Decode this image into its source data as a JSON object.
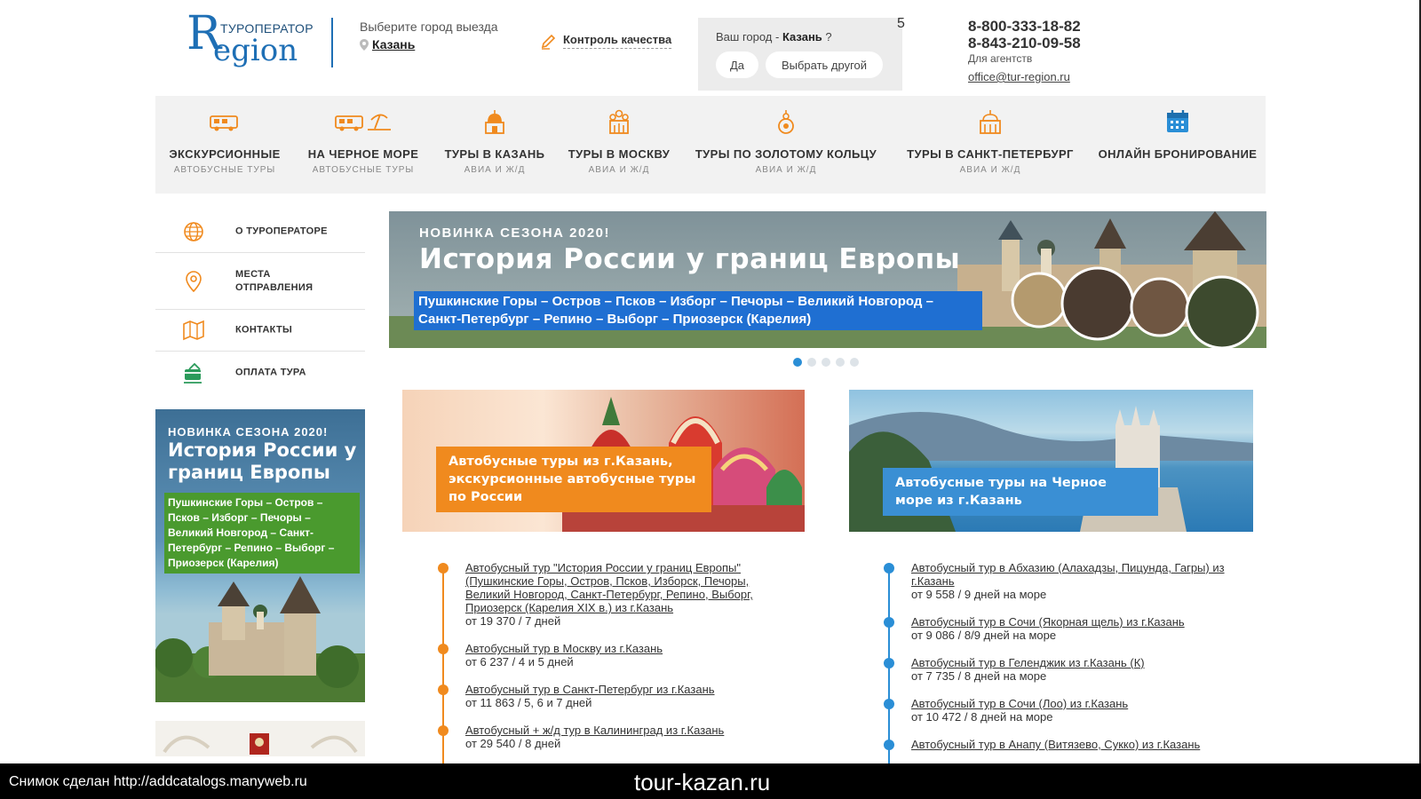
{
  "header": {
    "logo_small": "ТУРОПЕРАТОР",
    "logo_letter": "R",
    "logo_word": "egion",
    "city_label": "Выберите город выезда",
    "city_value": "Казань",
    "quality_label": "Контроль качества",
    "popup_question_prefix": "Ваш город - ",
    "popup_question_city": "Казань",
    "popup_question_suffix": " ?",
    "popup_yes": "Да",
    "popup_other": "Выбрать другой",
    "partial_digit": "5",
    "phone1": "8-800-333-18-82",
    "phone2": "8-843-210-09-58",
    "agents_label": "Для агентств",
    "email": "office@tur-region.ru"
  },
  "nav": [
    {
      "title": "ЭКСКУРСИОННЫЕ",
      "sub": "АВТОБУСНЫЕ ТУРЫ",
      "icon": "bus-icon"
    },
    {
      "title": "НА ЧЕРНОЕ МОРЕ",
      "sub": "АВТОБУСНЫЕ ТУРЫ",
      "icon": "bus-beach-icon"
    },
    {
      "title": "ТУРЫ В КАЗАНЬ",
      "sub": "АВИА И Ж/Д",
      "icon": "kazan-mosque-icon"
    },
    {
      "title": "ТУРЫ В МОСКВУ",
      "sub": "АВИА И Ж/Д",
      "icon": "moscow-cathedral-icon"
    },
    {
      "title": "ТУРЫ ПО ЗОЛОТОМУ КОЛЬЦУ",
      "sub": "АВИА И Ж/Д",
      "icon": "golden-ring-icon"
    },
    {
      "title": "ТУРЫ В САНКТ-ПЕТЕРБУРГ",
      "sub": "АВИА И Ж/Д",
      "icon": "spb-building-icon"
    },
    {
      "title": "ОНЛАЙН БРОНИРОВАНИЕ",
      "sub": "",
      "icon": "calendar-icon"
    }
  ],
  "sidebar": {
    "items": [
      {
        "label": "О ТУРОПЕРАТОРЕ",
        "icon": "globe-icon"
      },
      {
        "label": "МЕСТА ОТПРАВЛЕНИЯ",
        "icon": "location-pin-icon"
      },
      {
        "label": "КОНТАКТЫ",
        "icon": "map-icon"
      },
      {
        "label": "ОПЛАТА ТУРА",
        "icon": "payment-card-icon"
      }
    ],
    "promo_tag": "НОВИНКА СЕЗОНА 2020!",
    "promo_title": "История России у границ Европы",
    "promo_route": "Пушкинские Горы – Остров – Псков – Изборг – Печоры – Великий Новгород – Санкт-Петербург – Репино – Выборг – Приозерск (Карелия)"
  },
  "hero": {
    "tag": "НОВИНКА СЕЗОНА 2020!",
    "title": "История России у границ Европы",
    "route_line1": "Пушкинские Горы – Остров – Псков – Изборг – Печоры – Великий Новгород –",
    "route_line2": "Санкт-Петербург – Репино – Выборг – Приозерск (Карелия)",
    "slides_total": 5,
    "slide_active": 1
  },
  "banners": {
    "left_caption": "Автобусные туры из г.Казань, экскурсионные автобусные туры по России",
    "right_caption": "Автобусные туры на Черное море из г.Казань"
  },
  "tours_left": [
    {
      "name": "Автобусный тур \"История России у границ Европы\" (Пушкинские Горы, Остров, Псков, Изборск, Печоры, Великий Новгород, Санкт-Петербург, Репино, Выборг, Приозерск (Карелия XIX в.) из г.Казань",
      "price": "от 19 370 / 7 дней"
    },
    {
      "name": "Автобусный тур в Москву из г.Казань",
      "price": "от 6 237 / 4 и 5 дней"
    },
    {
      "name": "Автобусный тур в Санкт-Петербург из г.Казань",
      "price": "от 11 863 / 5, 6 и 7 дней"
    },
    {
      "name": "Автобусный + ж/д тур в Калининград из г.Казань",
      "price": "от 29 540 / 8 дней"
    }
  ],
  "tours_right": [
    {
      "name": "Автобусный тур в Абхазию (Алахадзы, Пицунда, Гагры) из г.Казань",
      "price": "от 9 558 / 9 дней на море"
    },
    {
      "name": "Автобусный тур в Сочи (Якорная щель) из г.Казань",
      "price": "от 9 086 / 8/9 дней на море"
    },
    {
      "name": "Автобусный тур в Геленджик из г.Казань (К)",
      "price": "от 7 735 / 8 дней на море"
    },
    {
      "name": "Автобусный тур в Сочи (Лоо) из г.Казань",
      "price": "от 10 472 / 8 дней на море"
    },
    {
      "name": "Автобусный тур в Анапу (Витязево, Сукко) из г.Казань",
      "price": ""
    }
  ],
  "footer": {
    "note": "Снимок сделан http://addcatalogs.manyweb.ru",
    "site": "tour-kazan.ru"
  },
  "colors": {
    "brand_blue": "#1e6fb5",
    "accent_orange": "#f08a1e",
    "accent_blue": "#2a8ed6",
    "route_green": "#4a9a2e",
    "hero_route_blue": "#1f6fd2"
  }
}
